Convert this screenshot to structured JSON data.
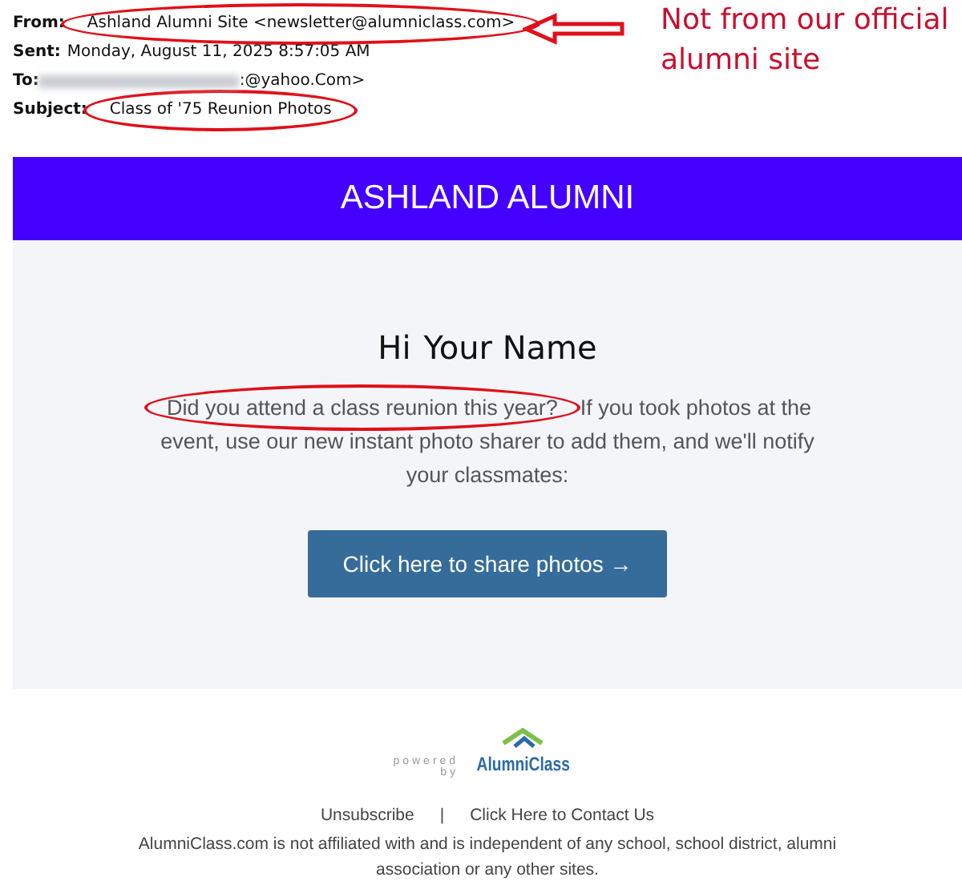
{
  "email_header": [
    {
      "label": "From:",
      "value": "Ashland Alumni Site <newsletter@alumniclass.com>",
      "redacted": false,
      "circled": true
    },
    {
      "label": "Sent:",
      "value": "Monday, August 11, 2025 8:57:05 AM",
      "redacted": false,
      "circled": false
    },
    {
      "label": "To:",
      "value": ":@yahoo.Com>",
      "redacted": true,
      "circled": false
    },
    {
      "label": "Subject:",
      "value": "Class of '75 Reunion Photos",
      "redacted": false,
      "circled": true
    }
  ],
  "annotation": {
    "text": "Not from our official alumni site"
  },
  "banner": {
    "title": "ASHLAND ALUMNI"
  },
  "greeting": {
    "hi": "Hi",
    "name": "Your Name"
  },
  "message": {
    "question": "Did you attend a class reunion this year?",
    "rest_start": "If you took photos at the",
    "rest_end": "event, use our new instant photo sharer to add them, and we'll notify your classmates:"
  },
  "cta_button": {
    "label": "Click here to share photos →"
  },
  "footer": {
    "logo": {
      "powered": "powered",
      "by": "by",
      "name": "AlumniClass"
    },
    "links": [
      {
        "label": "Unsubscribe"
      },
      {
        "label": "Click Here to Contact Us"
      }
    ],
    "separator": "|",
    "disclaimer": "AlumniClass.com is not affiliated with and is independent of any school, school district, alumni association or any other sites."
  }
}
